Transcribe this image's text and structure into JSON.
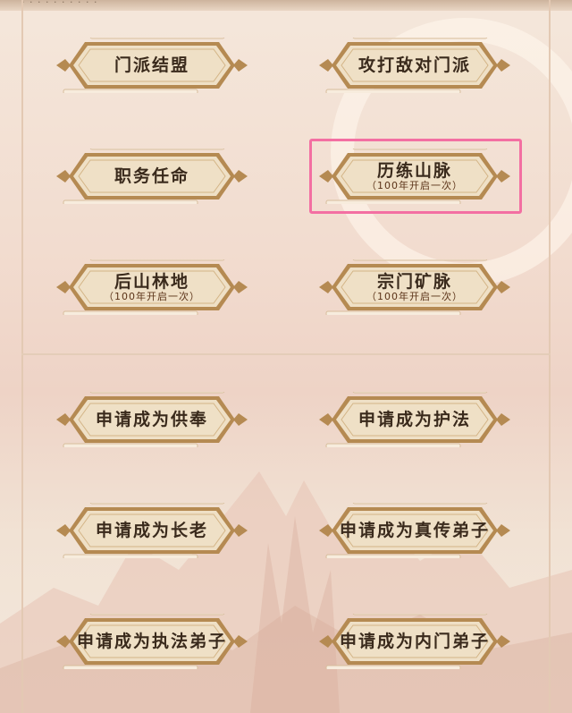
{
  "header": {
    "partial_text": "· · · · · · · · · ·"
  },
  "buttons": [
    {
      "id": "menpai-jiemeng",
      "label": "门派结盟",
      "sub": ""
    },
    {
      "id": "gongda-didui",
      "label": "攻打敌对门派",
      "sub": ""
    },
    {
      "id": "zhiwu-renming",
      "label": "职务任命",
      "sub": ""
    },
    {
      "id": "lilian-shanmai",
      "label": "历练山脉",
      "sub": "（100年开启一次）"
    },
    {
      "id": "houshan-lindi",
      "label": "后山林地",
      "sub": "（100年开启一次）"
    },
    {
      "id": "zongmen-kuangmai",
      "label": "宗门矿脉",
      "sub": "（100年开启一次）"
    },
    {
      "id": "gongfeng",
      "label": "申请成为供奉",
      "sub": ""
    },
    {
      "id": "hufa",
      "label": "申请成为护法",
      "sub": ""
    },
    {
      "id": "zhanglao",
      "label": "申请成为长老",
      "sub": ""
    },
    {
      "id": "zhenchuan",
      "label": "申请成为真传弟子",
      "sub": ""
    },
    {
      "id": "zhifa",
      "label": "申请成为执法弟子",
      "sub": ""
    },
    {
      "id": "neimen",
      "label": "申请成为内门弟子",
      "sub": ""
    }
  ],
  "colors": {
    "button_fill": "#efe0c6",
    "button_border": "#b58a52",
    "label": "#3a2a1c",
    "sub_label": "#5b3318",
    "highlight": "#f36fa2"
  }
}
